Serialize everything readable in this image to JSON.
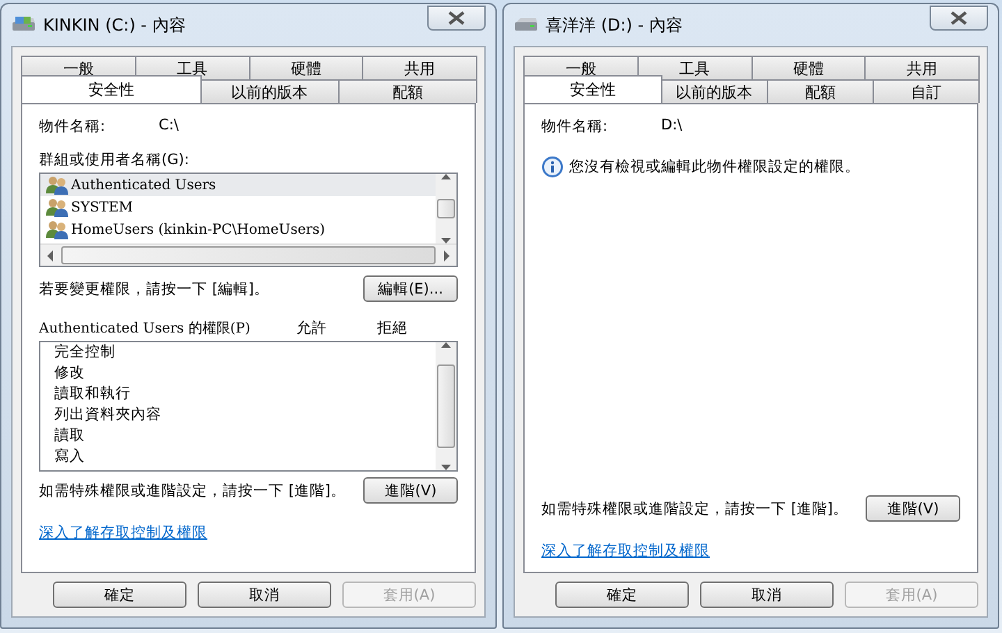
{
  "windows": [
    {
      "title": "KINKIN (C:) - 內容",
      "kind": "permissions",
      "tabs": [
        [
          {
            "label": "一般",
            "selected": false
          },
          {
            "label": "工具",
            "selected": false
          },
          {
            "label": "硬體",
            "selected": false
          },
          {
            "label": "共用",
            "selected": false
          }
        ],
        [
          {
            "label": "安全性",
            "selected": true
          },
          {
            "label": "以前的版本",
            "selected": false
          },
          {
            "label": "配額",
            "selected": false
          }
        ]
      ],
      "object_label": "物件名稱:",
      "object_value": "C:\\",
      "groups_label": "群組或使用者名稱(G):",
      "users": [
        {
          "name": "Authenticated Users",
          "selected": true
        },
        {
          "name": "SYSTEM",
          "selected": false
        },
        {
          "name": "HomeUsers (kinkin-PC\\HomeUsers)",
          "selected": false
        }
      ],
      "edit_text": "若要變更權限，請按一下 [編輯]。",
      "edit_button": "編輯(E)...",
      "permissions_label": "Authenticated Users 的權限(P)",
      "allow_label": "允許",
      "deny_label": "拒絕",
      "permissions": [
        "完全控制",
        "修改",
        "讀取和執行",
        "列出資料夾內容",
        "讀取",
        "寫入"
      ],
      "advanced_text": "如需特殊權限或進階設定，請按一下 [進階]。",
      "advanced_button": "進階(V)",
      "link": "深入了解存取控制及權限",
      "buttons": [
        {
          "label": "確定",
          "disabled": false
        },
        {
          "label": "取消",
          "disabled": false
        },
        {
          "label": "套用(A)",
          "disabled": true
        }
      ]
    },
    {
      "title": "喜洋洋 (D:) - 內容",
      "kind": "no_access",
      "tabs": [
        [
          {
            "label": "一般",
            "selected": false
          },
          {
            "label": "工具",
            "selected": false
          },
          {
            "label": "硬體",
            "selected": false
          },
          {
            "label": "共用",
            "selected": false
          }
        ],
        [
          {
            "label": "安全性",
            "selected": true
          },
          {
            "label": "以前的版本",
            "selected": false
          },
          {
            "label": "配額",
            "selected": false
          },
          {
            "label": "自訂",
            "selected": false
          }
        ]
      ],
      "object_label": "物件名稱:",
      "object_value": "D:\\",
      "message": "您沒有檢視或編輯此物件權限設定的權限。",
      "advanced_text": "如需特殊權限或進階設定，請按一下 [進階]。",
      "advanced_button": "進階(V)",
      "link": "深入了解存取控制及權限",
      "buttons": [
        {
          "label": "確定",
          "disabled": false
        },
        {
          "label": "取消",
          "disabled": false
        },
        {
          "label": "套用(A)",
          "disabled": true
        }
      ]
    }
  ]
}
